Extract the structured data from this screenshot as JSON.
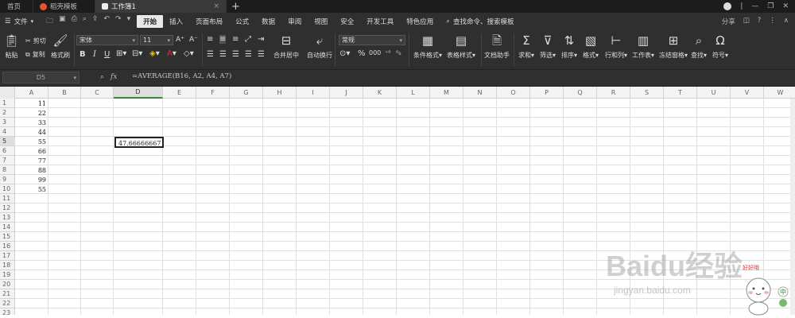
{
  "tabs": {
    "home": "首页",
    "templates": "稻壳模板",
    "doc": "工作簿1",
    "close": "×",
    "add": "+"
  },
  "window": {
    "minimize": "—",
    "maximize": "❐",
    "close": "✕",
    "separator": "|"
  },
  "menu": {
    "file": "文件",
    "items": [
      "开始",
      "插入",
      "页面布局",
      "公式",
      "数据",
      "审阅",
      "视图",
      "安全",
      "开发工具",
      "特色应用"
    ],
    "active": "开始",
    "search": "查找命令、搜索模板",
    "share": "分享"
  },
  "ribbon": {
    "paste": "粘贴",
    "cut": "剪切",
    "copy": "复制",
    "format_painter": "格式刷",
    "font": "宋体",
    "size": "11",
    "merge": "合并居中",
    "wrap": "自动换行",
    "number_format": "常规",
    "conditional": "条件格式",
    "table_style": "表格样式",
    "doc_helper": "文档助手",
    "sum": "求和",
    "filter": "筛选",
    "sort": "排序",
    "format": "格式",
    "rowcol": "行和列",
    "worksheet": "工作表",
    "freeze": "冻结窗格",
    "find": "查找",
    "symbol": "符号"
  },
  "formula_bar": {
    "name_box": "D5",
    "fx": "fx",
    "formula": "=AVERAGE(B16, A2, A4, A7)"
  },
  "columns": [
    "A",
    "B",
    "C",
    "D",
    "E",
    "F",
    "G",
    "H",
    "I",
    "J",
    "K",
    "L",
    "M",
    "N",
    "O",
    "P",
    "Q",
    "R",
    "S",
    "T",
    "U",
    "V",
    "W"
  ],
  "rows": [
    "1",
    "2",
    "3",
    "4",
    "5",
    "6",
    "7",
    "8",
    "9",
    "10",
    "11",
    "12",
    "13",
    "14",
    "15",
    "16",
    "17",
    "18",
    "19",
    "20",
    "21",
    "22",
    "23"
  ],
  "column_a": [
    "11",
    "22",
    "33",
    "44",
    "55",
    "66",
    "77",
    "88",
    "99",
    "55"
  ],
  "active_cell_value": "47.66666667",
  "selected_column": "D",
  "selected_row": "5",
  "mascot": {
    "bubble": "好好哦",
    "badge": "中"
  },
  "watermark": {
    "brand": "Baidu经验",
    "url": "jingyan.baidu.com"
  }
}
